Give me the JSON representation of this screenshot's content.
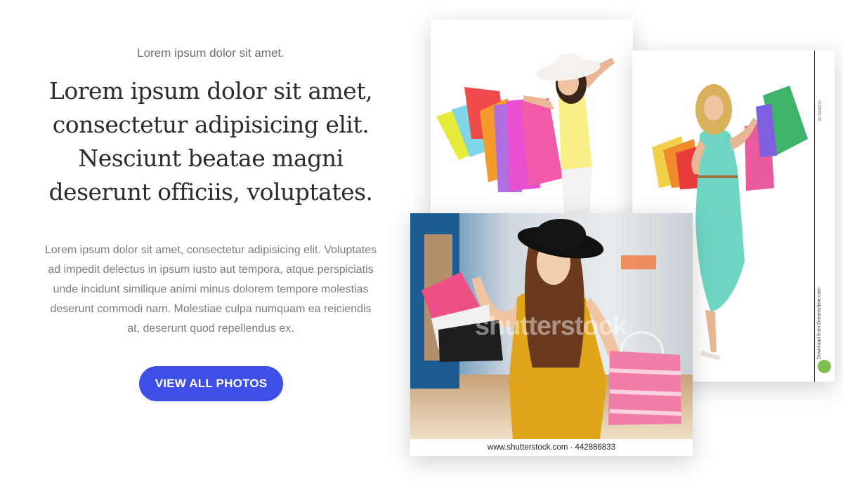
{
  "hero": {
    "eyebrow": "Lorem ipsum dolor sit amet.",
    "headline": "Lorem ipsum dolor sit amet, consectetur adipisicing elit. Nesciunt beatae magni deserunt officiis, voluptates.",
    "body": "Lorem ipsum dolor sit amet, consectetur adipisicing elit. Voluptates ad impedit delectus in ipsum iusto aut tempora, atque perspiciatis unde incidunt similique animi minus dolorem tempore molestias deserunt commodi nam. Molestiae culpa numquam ea reiciendis at, deserunt quod repellendus ex.",
    "cta_label": "VIEW ALL PHOTOS"
  },
  "gallery": {
    "photo_2_watermark": "Download from Dreamstime.com",
    "photo_3_watermark": "shutterstock",
    "photo_3_caption": "www.shutterstock.com · 442886833"
  },
  "colors": {
    "accent": "#3d4fe6",
    "heading": "#2c2c2c",
    "muted": "#7c7c7c"
  }
}
